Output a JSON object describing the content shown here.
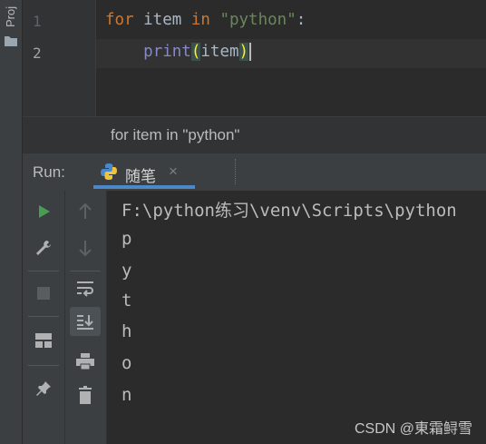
{
  "project_panel": {
    "label": "Proj"
  },
  "editor": {
    "lines": [
      {
        "number": "1",
        "tokens": {
          "kw_for": "for",
          "sp1": " item ",
          "kw_in": "in",
          "sp2": " ",
          "string": "\"python\"",
          "colon": ":"
        }
      },
      {
        "number": "2",
        "tokens": {
          "indent": "    ",
          "func": "print",
          "open_paren": "(",
          "arg": "item",
          "close_paren": ")"
        }
      }
    ]
  },
  "breadcrumb": {
    "text": "for item in \"python\""
  },
  "run_panel": {
    "label": "Run:",
    "tab": {
      "title": "随笔",
      "close": "×"
    }
  },
  "console": {
    "lines": [
      "F:\\python练习\\venv\\Scripts\\python",
      "p",
      "y",
      "t",
      "h",
      "o",
      "n"
    ]
  },
  "watermark": "CSDN @東霜鲟雪",
  "colors": {
    "keyword": "#cc7832",
    "string": "#6a8759",
    "builtin": "#8888c6",
    "run_green": "#499c54",
    "tab_accent": "#4a88c7"
  }
}
